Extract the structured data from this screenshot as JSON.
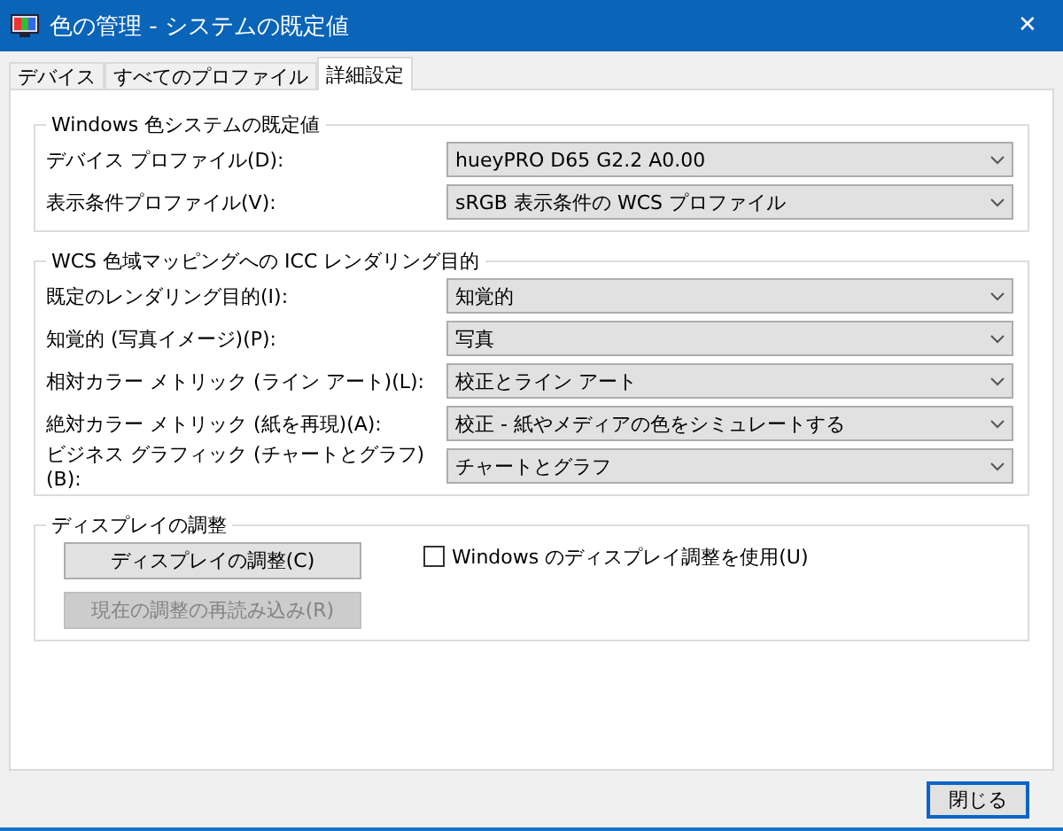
{
  "window": {
    "title": "色の管理 - システムの既定値",
    "close": "✕"
  },
  "tabs": [
    {
      "label": "デバイス",
      "selected": false
    },
    {
      "label": "すべてのプロファイル",
      "selected": false
    },
    {
      "label": "詳細設定",
      "selected": true
    }
  ],
  "groups": [
    {
      "title": "Windows 色システムの既定値",
      "rows": [
        {
          "label": "デバイス プロファイル(D):",
          "value": "hueyPRO D65 G2.2 A0.00"
        },
        {
          "label": "表示条件プロファイル(V):",
          "value": "sRGB 表示条件の WCS プロファイル"
        }
      ]
    },
    {
      "title": "WCS 色域マッピングへの ICC レンダリング目的",
      "rows": [
        {
          "label": "既定のレンダリング目的(I):",
          "value": "知覚的"
        },
        {
          "label": "知覚的 (写真イメージ)(P):",
          "value": "写真"
        },
        {
          "label": "相対カラー メトリック (ライン アート)(L):",
          "value": "校正とライン アート"
        },
        {
          "label": "絶対カラー メトリック (紙を再現)(A):",
          "value": "校正 - 紙やメディアの色をシミュレートする"
        },
        {
          "label": "ビジネス グラフィック (チャートとグラフ)(B):",
          "value": "チャートとグラフ"
        }
      ]
    }
  ],
  "display": {
    "title": "ディスプレイの調整",
    "buttons": [
      {
        "label": "ディスプレイの調整(C)",
        "disabled": false
      },
      {
        "label": "現在の調整の再読み込み(R)",
        "disabled": true
      }
    ],
    "checkbox": {
      "label": "Windows のディスプレイ調整を使用(U)",
      "checked": false
    }
  },
  "footer_button": "閉じる"
}
